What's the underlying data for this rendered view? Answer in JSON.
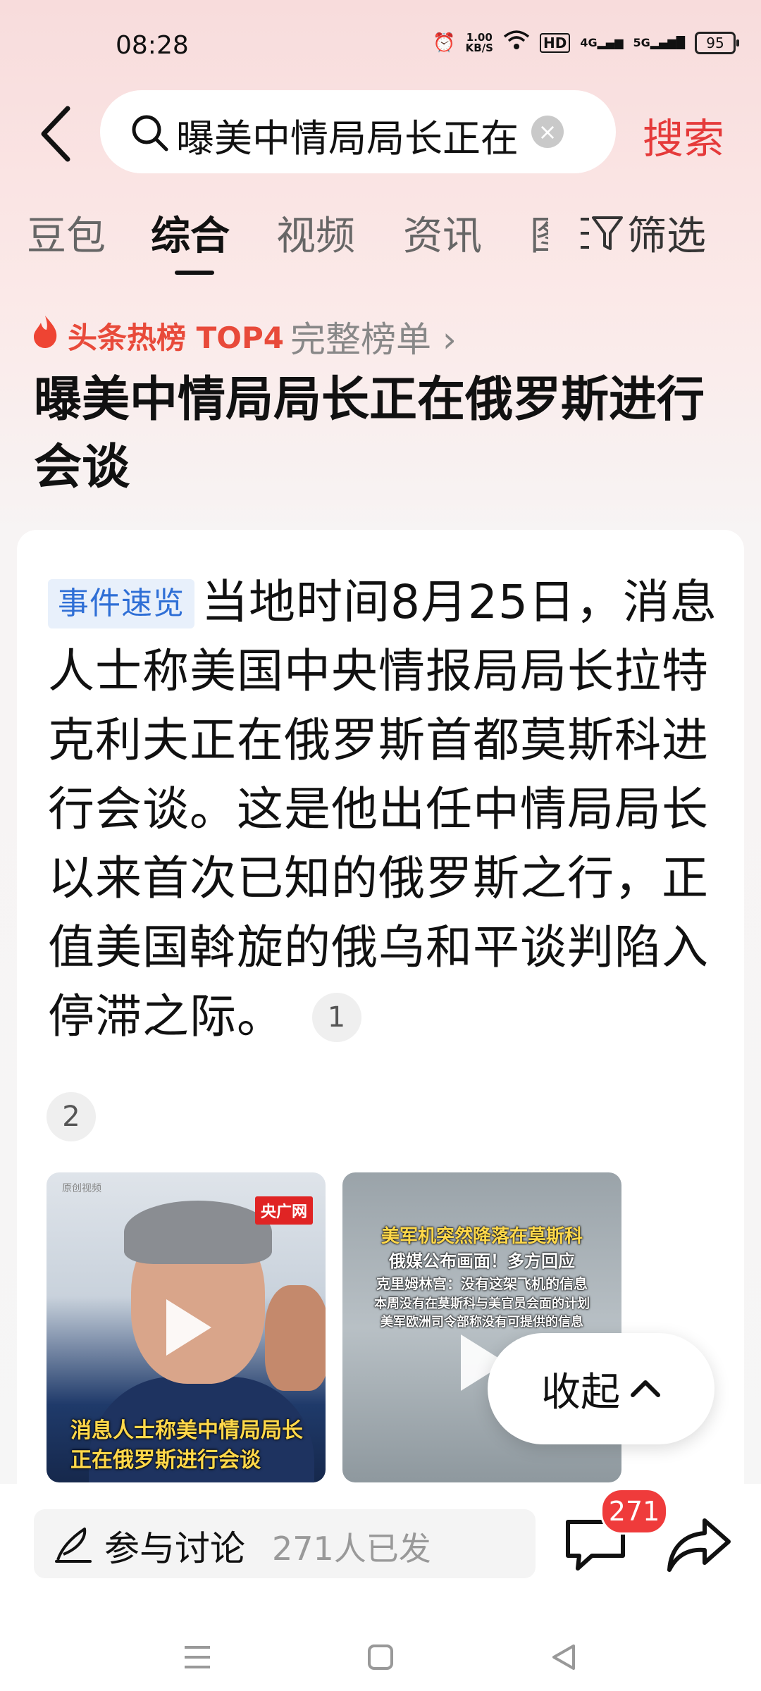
{
  "status_bar": {
    "time": "08:28",
    "net_speed_value": "1.00",
    "net_speed_unit": "KB/S",
    "hd": "HD",
    "sim1": "4G",
    "sim2": "5G",
    "battery": "95"
  },
  "search": {
    "query": "曝美中情局局长正在",
    "button_label": "搜索"
  },
  "tabs": [
    {
      "label": "豆包",
      "active": false
    },
    {
      "label": "综合",
      "active": true
    },
    {
      "label": "视频",
      "active": false
    },
    {
      "label": "资讯",
      "active": false
    },
    {
      "label": "图",
      "active": false
    }
  ],
  "filter_label": "筛选",
  "hot": {
    "label": "头条热榜 TOP4",
    "full_list": "完整榜单 ›"
  },
  "headline": "曝美中情局局长正在俄罗斯进行会谈",
  "summary": {
    "tag": "事件速览",
    "text": "当地时间8月25日，消息人士称美国中央情报局局长拉特克利夫正在俄罗斯首都莫斯科进行会谈。这是他出任中情局局长以来首次已知的俄罗斯之行，正值美国斡旋的俄乌和平谈判陷入停滞之际。",
    "refs": [
      "1",
      "2"
    ]
  },
  "videos": [
    {
      "caption": "消息人士称美中情局局长正在俄罗斯进行会谈",
      "logo": "央广网",
      "watermark": "原创视频"
    },
    {
      "lines": [
        "美军机突然降落在莫斯科",
        "俄媒公布画面！多方回应",
        "克里姆林宫：没有这架飞机的信息",
        "本周没有在莫斯科与美官员会面的计划",
        "美军欧洲司令部称没有可提供的信息"
      ]
    }
  ],
  "collapse_label": "收起",
  "bottom": {
    "discuss_label": "参与讨论",
    "discuss_count": "271人已发",
    "comment_badge": "271"
  },
  "colors": {
    "accent": "#e53a3a",
    "tag_blue": "#2f6fd6",
    "badge_red": "#ef3b3b"
  }
}
